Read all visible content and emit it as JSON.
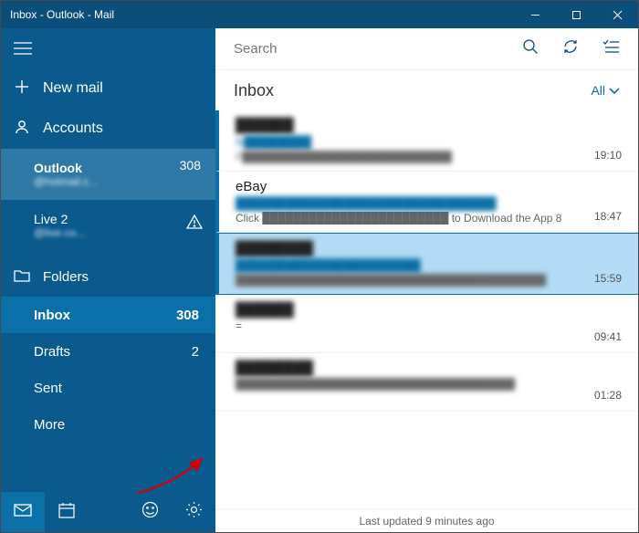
{
  "window": {
    "title": "Inbox - Outlook - Mail"
  },
  "sidebar": {
    "newmail_label": "New mail",
    "accounts_label": "Accounts",
    "accounts": [
      {
        "name": "Outlook",
        "email": "@hotmail.c...",
        "count": "308"
      },
      {
        "name": "Live 2",
        "email": "@live.co...",
        "count": ""
      }
    ],
    "folders_label": "Folders",
    "folders": [
      {
        "label": "Inbox",
        "count": "308"
      },
      {
        "label": "Drafts",
        "count": "2"
      },
      {
        "label": "Sent",
        "count": ""
      },
      {
        "label": "More",
        "count": ""
      }
    ]
  },
  "search": {
    "placeholder": "Search"
  },
  "header": {
    "folder_name": "Inbox",
    "filter_label": "All"
  },
  "messages": [
    {
      "sender": "██████",
      "subject": "N████████",
      "preview": "F███████████████████████████",
      "time": "19:10"
    },
    {
      "sender": "eBay",
      "subject": "███████████████████████████████",
      "preview": "Click ████████████████████████ to Download the App 8",
      "time": "18:47"
    },
    {
      "sender": "████████",
      "subject": "██████████████████████",
      "preview": "████████████████████████████████████████",
      "time": "15:59"
    },
    {
      "sender": "██████",
      "subject": "",
      "preview": "=",
      "time": "09:41"
    },
    {
      "sender": "████████",
      "subject": "",
      "preview": "████████████████████████████████████",
      "time": "01:28"
    }
  ],
  "status": {
    "text": "Last updated 9 minutes ago"
  }
}
